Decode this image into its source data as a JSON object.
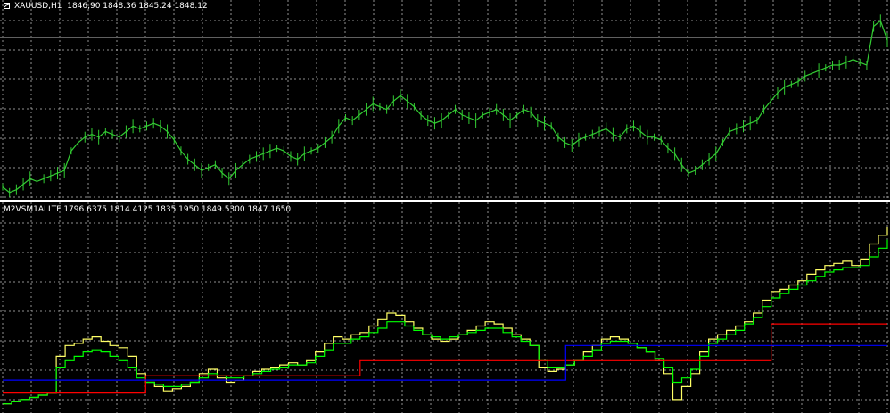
{
  "window": {
    "symbol_info": "XAUUSD,H1  1846,90 1848.36 1845.24 1848.12",
    "indicator_info": "M2VSM1ALLTF 1796.6375 1814.4125 1835.1950 1849.5300 1847.1650"
  },
  "colors": {
    "background": "#000000",
    "grid": "#c0c0c0",
    "candles": "#33cc33",
    "separator": "#ffffff",
    "bid_line": "#c0c0c0",
    "yellow_line": "#ffff66",
    "green_line": "#00ff00",
    "red_line": "#ff0000",
    "blue_line": "#0000ff"
  },
  "chart_data": [
    {
      "type": "line",
      "name_text": "XAUUSD,H1",
      "series": [
        {
          "values": [
            1812,
            1810,
            1811,
            1813,
            1815,
            1814,
            1815,
            1816,
            1817,
            1818,
            1825,
            1828,
            1830,
            1831,
            1830,
            1832,
            1831,
            1830,
            1832,
            1834,
            1833,
            1834,
            1835,
            1834,
            1832,
            1829,
            1825,
            1822,
            1820,
            1818,
            1819,
            1820,
            1817,
            1815,
            1818,
            1820,
            1822,
            1823,
            1824,
            1825,
            1826,
            1825,
            1823,
            1822,
            1824,
            1825,
            1826,
            1828,
            1830,
            1834,
            1837,
            1836,
            1838,
            1840,
            1842,
            1841,
            1840,
            1843,
            1845,
            1843,
            1841,
            1838,
            1836,
            1835,
            1836,
            1838,
            1840,
            1838,
            1837,
            1836,
            1838,
            1839,
            1840,
            1838,
            1836,
            1838,
            1840,
            1839,
            1836,
            1835,
            1834,
            1830,
            1828,
            1827,
            1829,
            1830,
            1831,
            1832,
            1833,
            1831,
            1830,
            1833,
            1834,
            1832,
            1830,
            1830,
            1829,
            1826,
            1824,
            1820,
            1817,
            1818,
            1820,
            1822,
            1824,
            1828,
            1832,
            1833,
            1834,
            1835,
            1836,
            1840,
            1843,
            1846,
            1848,
            1849,
            1850,
            1852,
            1853,
            1854,
            1855,
            1856,
            1856,
            1857,
            1858,
            1857,
            1856,
            1870,
            1872,
            1865
          ],
          "color_key": "candles"
        }
      ],
      "ylim": [
        1808,
        1875
      ],
      "bid_line": 1866
    },
    {
      "type": "line",
      "series": [
        {
          "color_key": "yellow_line",
          "values": [
            1798,
            1799,
            1800,
            1801,
            1802,
            1803,
            1820,
            1825,
            1826,
            1828,
            1829,
            1827,
            1825,
            1824,
            1820,
            1812,
            1808,
            1806,
            1804,
            1805,
            1806,
            1808,
            1812,
            1814,
            1810,
            1808,
            1809,
            1811,
            1813,
            1814,
            1815,
            1816,
            1817,
            1816,
            1818,
            1822,
            1826,
            1829,
            1828,
            1830,
            1831,
            1834,
            1837,
            1840,
            1839,
            1836,
            1833,
            1830,
            1828,
            1827,
            1828,
            1830,
            1832,
            1834,
            1836,
            1835,
            1833,
            1830,
            1828,
            1825,
            1815,
            1813,
            1814,
            1816,
            1818,
            1822,
            1825,
            1828,
            1829,
            1828,
            1826,
            1824,
            1822,
            1818,
            1812,
            1800,
            1806,
            1812,
            1822,
            1828,
            1830,
            1832,
            1834,
            1836,
            1840,
            1846,
            1850,
            1851,
            1853,
            1855,
            1858,
            1860,
            1862,
            1863,
            1864,
            1862,
            1865,
            1872,
            1876,
            1880
          ]
        },
        {
          "color_key": "green_line",
          "values": [
            1798,
            1799,
            1800,
            1801,
            1802,
            1803,
            1815,
            1818,
            1820,
            1822,
            1823,
            1822,
            1820,
            1818,
            1815,
            1810,
            1808,
            1807,
            1806,
            1806,
            1807,
            1808,
            1810,
            1812,
            1811,
            1810,
            1810,
            1811,
            1812,
            1813,
            1814,
            1815,
            1816,
            1816,
            1817,
            1820,
            1823,
            1826,
            1826,
            1828,
            1829,
            1831,
            1833,
            1836,
            1836,
            1834,
            1832,
            1830,
            1829,
            1828,
            1829,
            1830,
            1831,
            1832,
            1833,
            1833,
            1831,
            1829,
            1827,
            1825,
            1818,
            1815,
            1815,
            1816,
            1818,
            1820,
            1823,
            1826,
            1827,
            1827,
            1826,
            1824,
            1822,
            1819,
            1815,
            1808,
            1810,
            1814,
            1820,
            1826,
            1828,
            1830,
            1832,
            1835,
            1838,
            1843,
            1847,
            1849,
            1851,
            1853,
            1855,
            1857,
            1859,
            1860,
            1861,
            1861,
            1862,
            1866,
            1870,
            1874
          ]
        },
        {
          "color_key": "red_line",
          "values": [
            1803,
            1803,
            1803,
            1803,
            1803,
            1803,
            1803,
            1803,
            1803,
            1803,
            1803,
            1803,
            1803,
            1803,
            1803,
            1803,
            1811,
            1811,
            1811,
            1811,
            1811,
            1811,
            1811,
            1811,
            1811,
            1811,
            1811,
            1811,
            1811,
            1811,
            1811,
            1811,
            1811,
            1811,
            1811,
            1811,
            1811,
            1811,
            1811,
            1811,
            1818,
            1818,
            1818,
            1818,
            1818,
            1818,
            1818,
            1818,
            1818,
            1818,
            1818,
            1818,
            1818,
            1818,
            1818,
            1818,
            1818,
            1818,
            1818,
            1818,
            1818,
            1818,
            1818,
            1818,
            1818,
            1818,
            1818,
            1818,
            1818,
            1818,
            1818,
            1818,
            1818,
            1818,
            1818,
            1818,
            1818,
            1818,
            1818,
            1818,
            1818,
            1818,
            1818,
            1818,
            1818,
            1818,
            1835,
            1835,
            1835,
            1835,
            1835,
            1835,
            1835,
            1835,
            1835,
            1835,
            1835,
            1835,
            1835,
            1835
          ]
        },
        {
          "color_key": "blue_line",
          "values": [
            1809,
            1809,
            1809,
            1809,
            1809,
            1809,
            1809,
            1809,
            1809,
            1809,
            1809,
            1809,
            1809,
            1809,
            1809,
            1809,
            1809,
            1809,
            1809,
            1809,
            1809,
            1809,
            1809,
            1809,
            1809,
            1809,
            1809,
            1809,
            1809,
            1809,
            1809,
            1809,
            1809,
            1809,
            1809,
            1809,
            1809,
            1809,
            1809,
            1809,
            1809,
            1809,
            1809,
            1809,
            1809,
            1809,
            1809,
            1809,
            1809,
            1809,
            1809,
            1809,
            1809,
            1809,
            1809,
            1809,
            1809,
            1809,
            1809,
            1809,
            1809,
            1809,
            1809,
            1825,
            1825,
            1825,
            1825,
            1825,
            1825,
            1825,
            1825,
            1825,
            1825,
            1825,
            1825,
            1825,
            1825,
            1825,
            1825,
            1825,
            1825,
            1825,
            1825,
            1825,
            1825,
            1825,
            1825,
            1825,
            1825,
            1825,
            1825,
            1825,
            1825,
            1825,
            1825,
            1825,
            1825,
            1825,
            1825,
            1825
          ]
        }
      ],
      "ylim": [
        1795,
        1885
      ]
    }
  ]
}
